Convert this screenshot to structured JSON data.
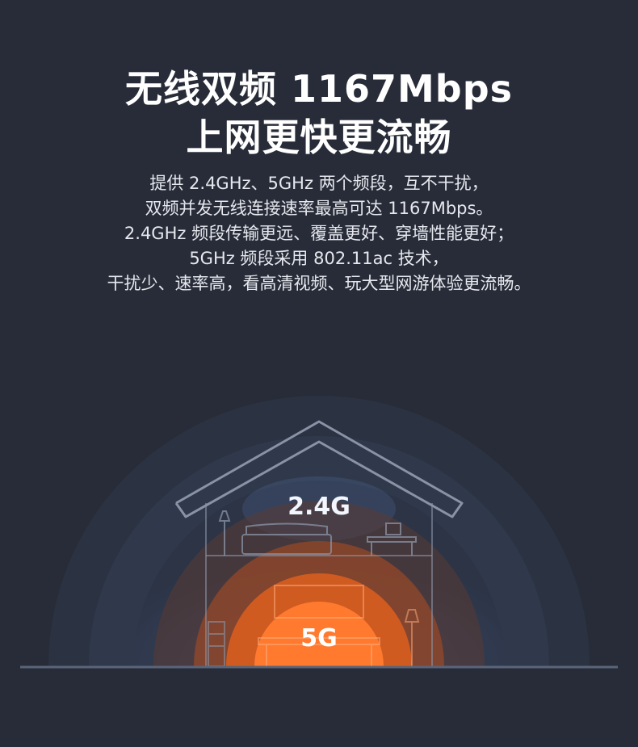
{
  "headline": {
    "line1": "无线双频 1167Mbps",
    "line2": "上网更快更流畅"
  },
  "description": {
    "lines": [
      "提供 2.4GHz、5GHz 两个频段，互不干扰，",
      "双频并发无线连接速率最高可达 1167Mbps。",
      "2.4GHz 频段传输更远、覆盖更好、穿墙性能更好；",
      "5GHz 频段采用 802.11ac 技术，",
      "干扰少、速率高，看高清视频、玩大型网游体验更流畅。"
    ]
  },
  "bands": {
    "band_24": "2.4G",
    "band_5g": "5G"
  },
  "colors": {
    "background": "#272c38",
    "band_24_glow": "#3d4d6e",
    "band_5g_glow": "#ff6a1a",
    "house_outline": "#8a93a6"
  }
}
